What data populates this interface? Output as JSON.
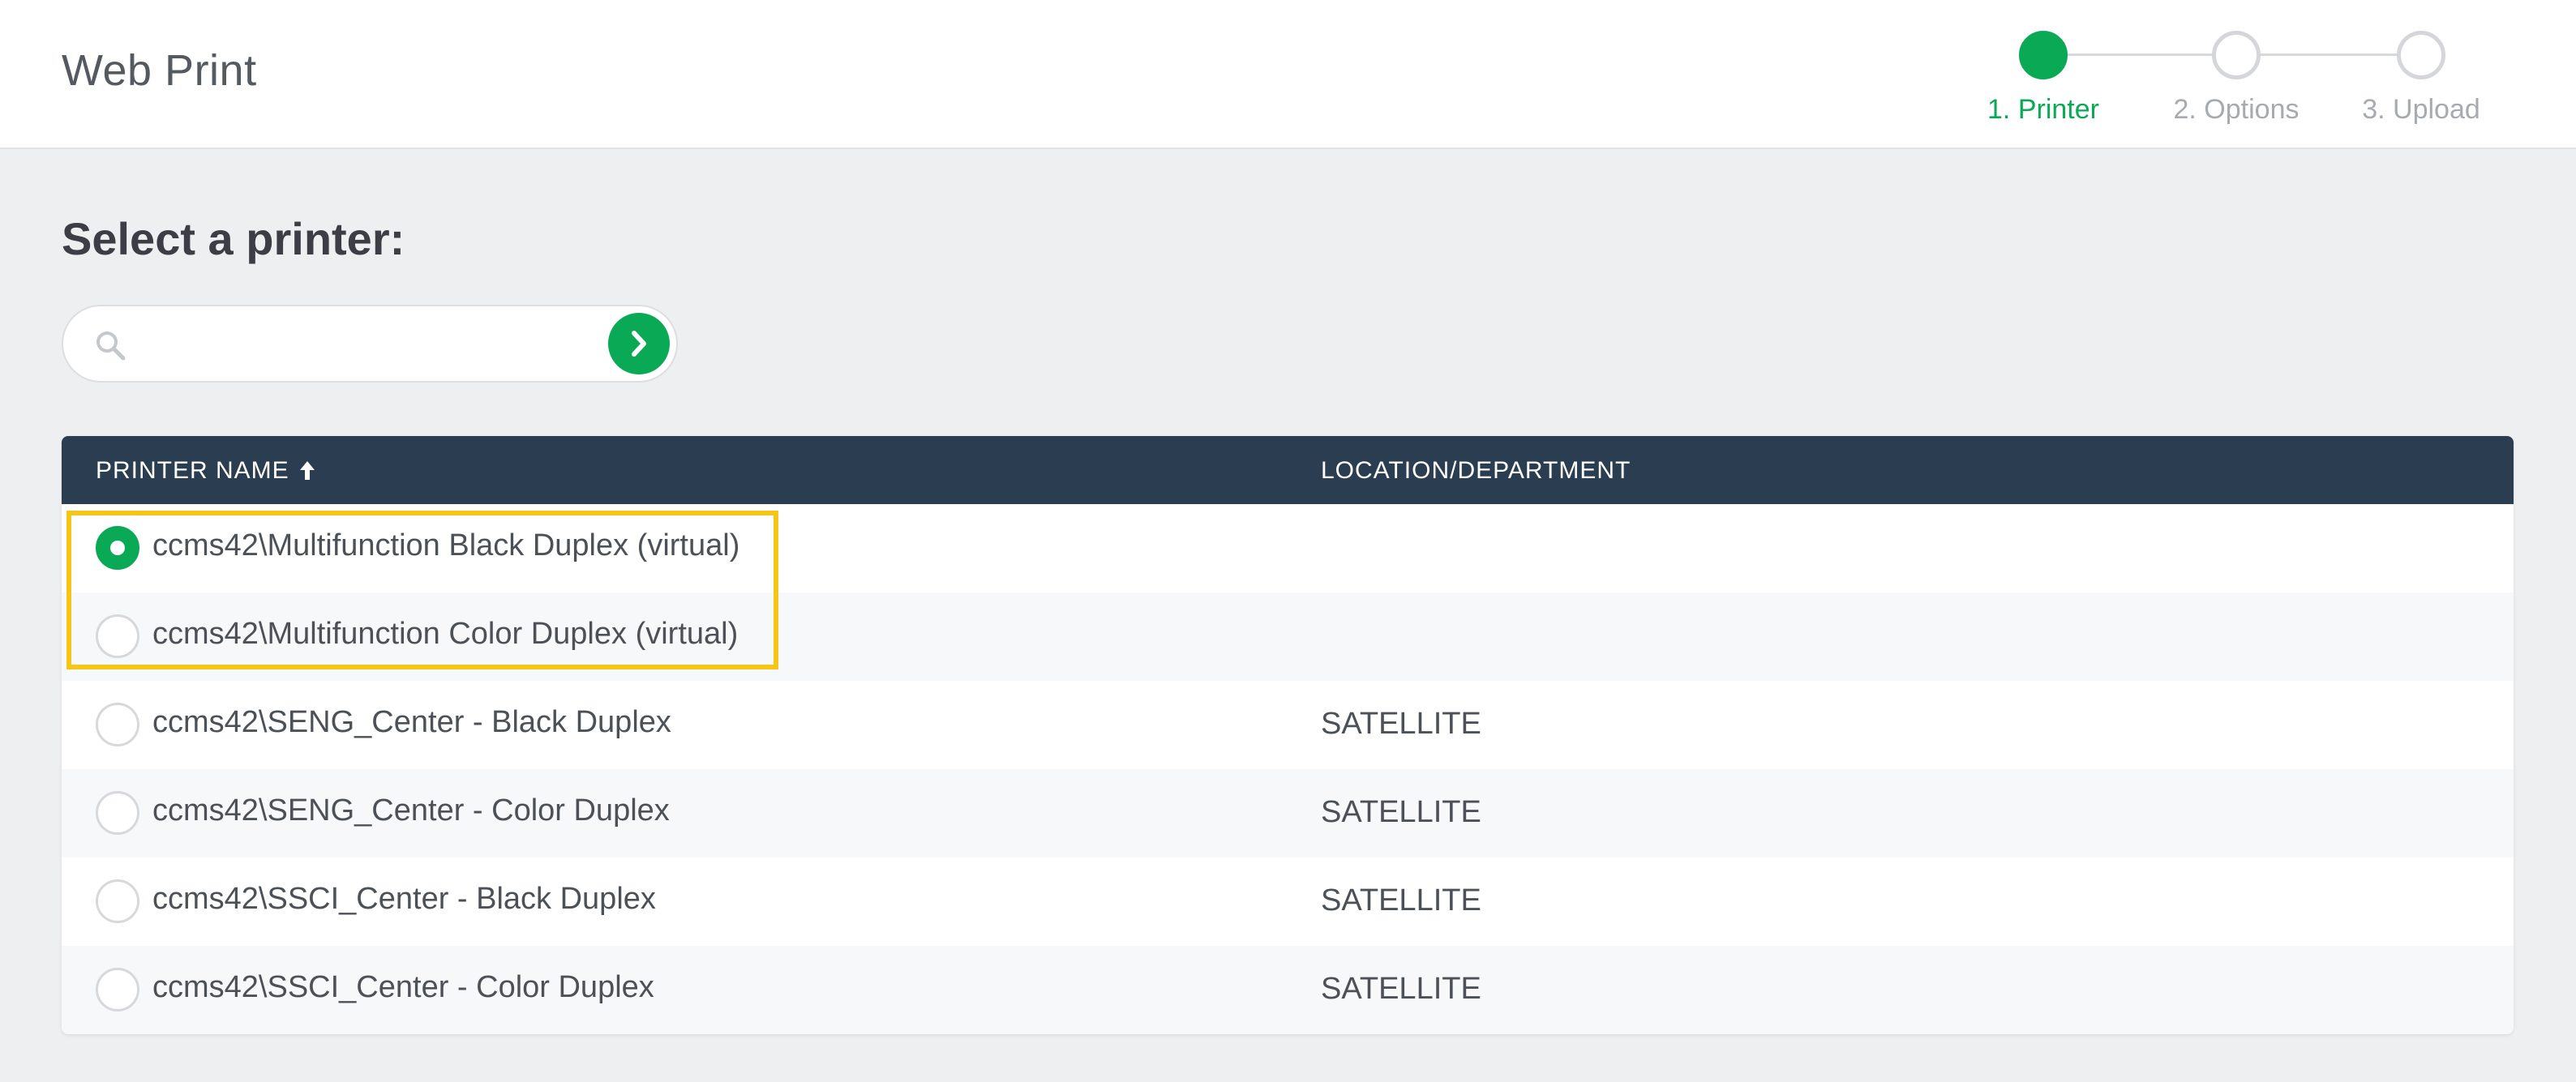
{
  "header": {
    "title": "Web Print"
  },
  "stepper": {
    "steps": [
      {
        "label": "1. Printer",
        "active": true
      },
      {
        "label": "2. Options",
        "active": false
      },
      {
        "label": "3. Upload",
        "active": false
      }
    ]
  },
  "main": {
    "title": "Select a printer:",
    "search": {
      "value": "",
      "placeholder": "",
      "icon": "search-icon",
      "submit_icon": "chevron-right-icon"
    }
  },
  "table": {
    "columns": [
      {
        "label": "PRINTER NAME",
        "sort": "ascending",
        "sort_icon": "arrow-up-icon"
      },
      {
        "label": "LOCATION/DEPARTMENT"
      }
    ],
    "rows": [
      {
        "name": "ccms42\\Multifunction Black Duplex (virtual)",
        "location": "",
        "selected": true
      },
      {
        "name": "ccms42\\Multifunction Color Duplex (virtual)",
        "location": "",
        "selected": false
      },
      {
        "name": "ccms42\\SENG_Center - Black Duplex",
        "location": "SATELLITE",
        "selected": false
      },
      {
        "name": "ccms42\\SENG_Center - Color Duplex",
        "location": "SATELLITE",
        "selected": false
      },
      {
        "name": "ccms42\\SSCI_Center - Black Duplex",
        "location": "SATELLITE",
        "selected": false
      },
      {
        "name": "ccms42\\SSCI_Center - Color Duplex",
        "location": "SATELLITE",
        "selected": false
      }
    ]
  },
  "colors": {
    "accent": "#0aa955",
    "table_header": "#2b3d50",
    "highlight": "#f5c518",
    "background": "#eeeff1"
  }
}
